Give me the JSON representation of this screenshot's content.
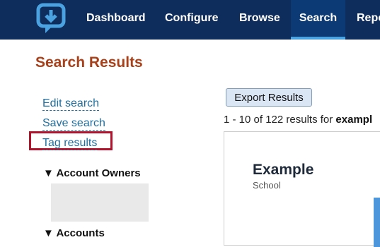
{
  "nav": {
    "items": [
      {
        "label": "Dashboard",
        "active": false
      },
      {
        "label": "Configure",
        "active": false
      },
      {
        "label": "Browse",
        "active": false
      },
      {
        "label": "Search",
        "active": true
      },
      {
        "label": "Repo",
        "active": false
      }
    ]
  },
  "page": {
    "title": "Search Results"
  },
  "sidebar": {
    "links": [
      "Edit search",
      "Save search",
      "Tag results"
    ],
    "facets": [
      "▼ Account Owners",
      "▼ Accounts"
    ]
  },
  "results": {
    "export_label": "Export Results",
    "summary_prefix": "1 - 10 of 122 results for ",
    "summary_query": "exampl",
    "card": {
      "title": "Example",
      "subtitle": "School"
    }
  },
  "colors": {
    "nav_bg": "#0f2d5c",
    "title": "#a8401a",
    "link": "#1f6fa0",
    "highlight": "#b0132b",
    "accent": "#4e96dc"
  }
}
